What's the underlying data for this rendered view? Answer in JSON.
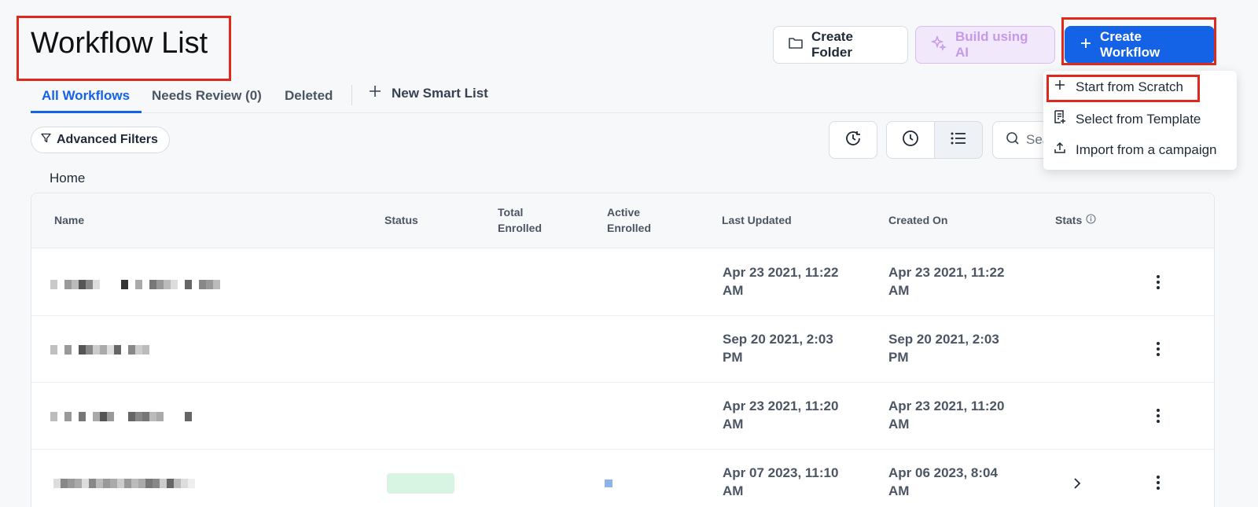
{
  "header": {
    "title": "Workflow List",
    "buttons": {
      "create_folder": "Create Folder",
      "build_ai": "Build using AI",
      "create_workflow": "Create Workflow"
    }
  },
  "tabs": {
    "all": "All Workflows",
    "needs_review": "Needs Review (0)",
    "deleted": "Deleted",
    "new_smart_list": "New Smart List"
  },
  "filters": {
    "advanced": "Advanced Filters",
    "search_placeholder": "Sea"
  },
  "breadcrumb": "Home",
  "table": {
    "headers": {
      "name": "Name",
      "status": "Status",
      "total_enrolled": "Total Enrolled",
      "active_enrolled": "Active Enrolled",
      "last_updated": "Last Updated",
      "created_on": "Created On",
      "stats": "Stats"
    },
    "rows": [
      {
        "last_updated": "Apr 23 2021, 11:22 AM",
        "created_on": "Apr 23 2021, 11:22 AM"
      },
      {
        "last_updated": "Sep 20 2021, 2:03 PM",
        "created_on": "Sep 20 2021, 2:03 PM"
      },
      {
        "last_updated": "Apr 23 2021, 11:20 AM",
        "created_on": "Apr 23 2021, 11:20 AM"
      },
      {
        "last_updated": "Apr 07 2023, 11:10 AM",
        "created_on": "Apr 06 2023, 8:04 AM"
      }
    ]
  },
  "dropdown": {
    "items": [
      "Start from Scratch",
      "Select from Template",
      "Import from a campaign"
    ]
  },
  "colors": {
    "accent": "#1463e6",
    "highlight": "#e0291d"
  }
}
